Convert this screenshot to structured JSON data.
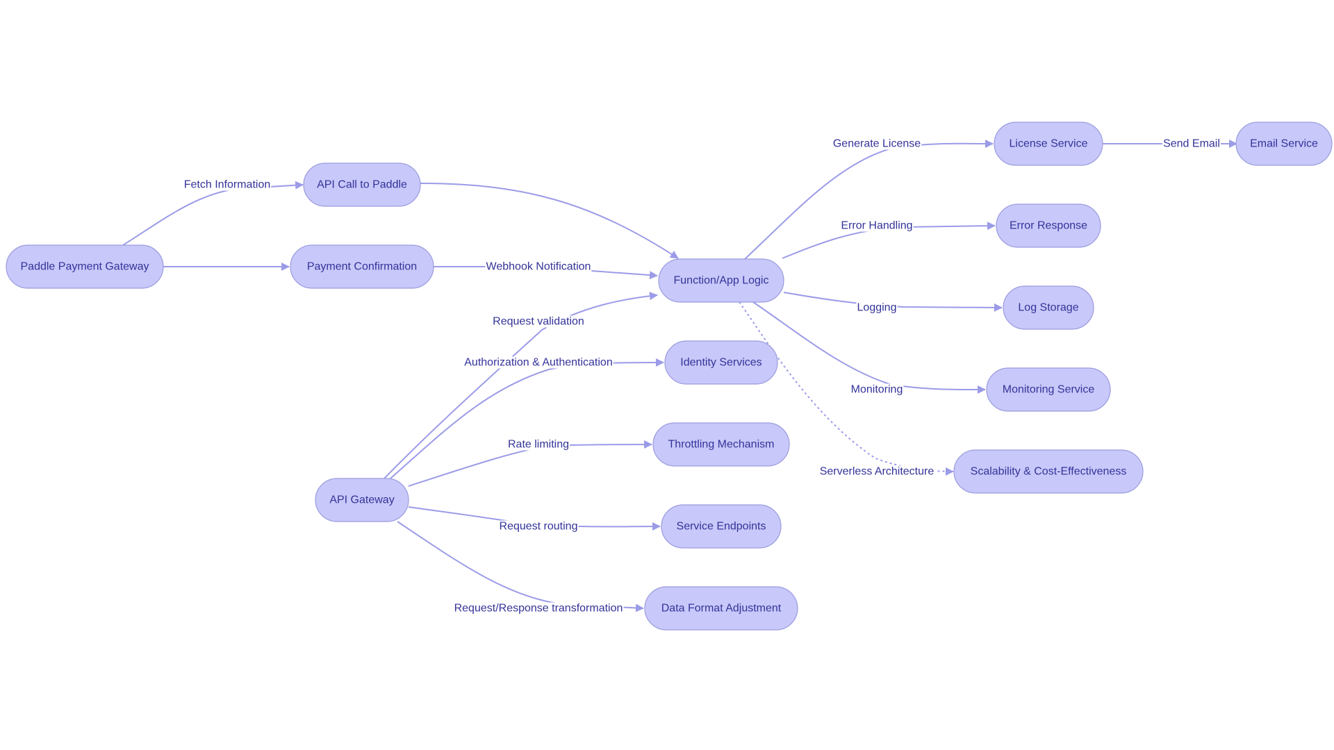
{
  "diagram": {
    "type": "flowchart",
    "direction": "left-to-right",
    "colors": {
      "node_fill": "#c8c8fa",
      "node_border": "#9b9bdf",
      "text": "#333399",
      "edge": "#9b9be8",
      "background": "#ffffff"
    },
    "nodes": [
      {
        "id": "paddle",
        "label": "Paddle Payment Gateway"
      },
      {
        "id": "apicall",
        "label": "API Call to Paddle"
      },
      {
        "id": "payconf",
        "label": "Payment Confirmation"
      },
      {
        "id": "func",
        "label": "Function/App Logic"
      },
      {
        "id": "apigw",
        "label": "API Gateway"
      },
      {
        "id": "identity",
        "label": "Identity Services"
      },
      {
        "id": "throttle",
        "label": "Throttling Mechanism"
      },
      {
        "id": "endpoints",
        "label": "Service Endpoints"
      },
      {
        "id": "dataformat",
        "label": "Data Format Adjustment"
      },
      {
        "id": "license",
        "label": "License Service"
      },
      {
        "id": "email",
        "label": "Email Service"
      },
      {
        "id": "error",
        "label": "Error Response"
      },
      {
        "id": "log",
        "label": "Log Storage"
      },
      {
        "id": "monitor",
        "label": "Monitoring Service"
      },
      {
        "id": "scal",
        "label": "Scalability & Cost-Effectiveness"
      }
    ],
    "edges": [
      {
        "from": "paddle",
        "to": "apicall",
        "label": "Fetch Information",
        "style": "solid"
      },
      {
        "from": "paddle",
        "to": "payconf",
        "label": "",
        "style": "solid"
      },
      {
        "from": "apicall",
        "to": "func",
        "label": "",
        "style": "solid"
      },
      {
        "from": "payconf",
        "to": "func",
        "label": "Webhook Notification",
        "style": "solid"
      },
      {
        "from": "apigw",
        "to": "func",
        "label": "Request validation",
        "style": "solid"
      },
      {
        "from": "apigw",
        "to": "identity",
        "label": "Authorization & Authentication",
        "style": "solid"
      },
      {
        "from": "apigw",
        "to": "throttle",
        "label": "Rate limiting",
        "style": "solid"
      },
      {
        "from": "apigw",
        "to": "endpoints",
        "label": "Request routing",
        "style": "solid"
      },
      {
        "from": "apigw",
        "to": "dataformat",
        "label": "Request/Response transformation",
        "style": "solid"
      },
      {
        "from": "func",
        "to": "license",
        "label": "Generate License",
        "style": "solid"
      },
      {
        "from": "license",
        "to": "email",
        "label": "Send Email",
        "style": "solid"
      },
      {
        "from": "func",
        "to": "error",
        "label": "Error Handling",
        "style": "solid"
      },
      {
        "from": "func",
        "to": "log",
        "label": "Logging",
        "style": "solid"
      },
      {
        "from": "func",
        "to": "monitor",
        "label": "Monitoring",
        "style": "solid"
      },
      {
        "from": "func",
        "to": "scal",
        "label": "Serverless Architecture",
        "style": "dotted"
      }
    ]
  }
}
